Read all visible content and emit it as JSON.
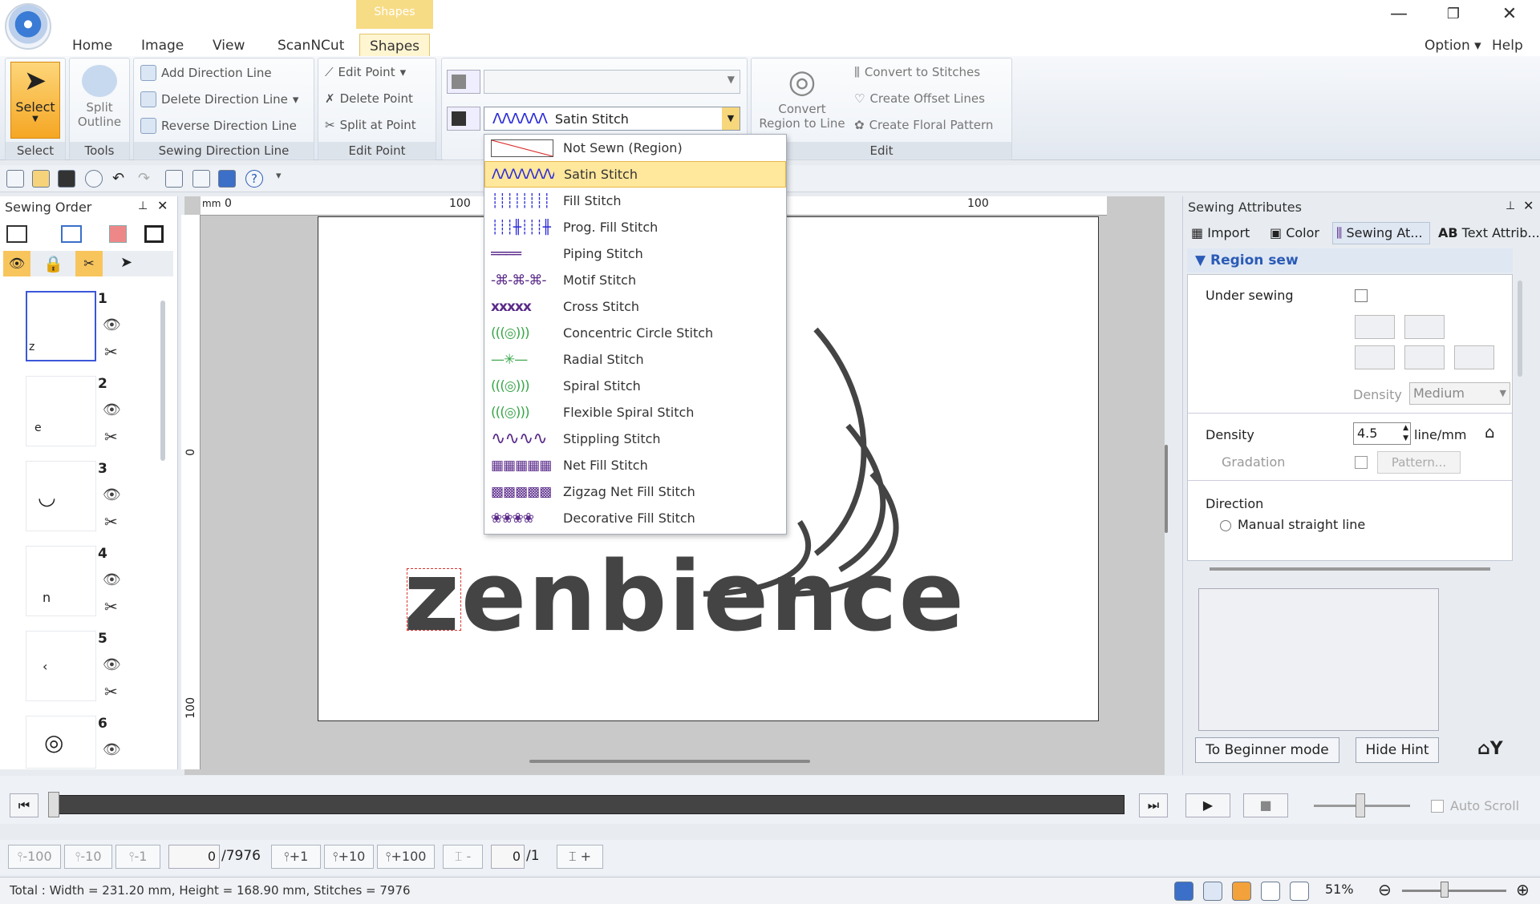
{
  "ribbon": {
    "context_tab": "Shapes",
    "tabs": [
      "Home",
      "Image",
      "View",
      "ScanNCut",
      "Shapes"
    ],
    "active_tab": "Shapes",
    "option_label": "Option",
    "help_label": "Help",
    "groups": {
      "select": {
        "label": "Select",
        "button": "Select"
      },
      "tools": {
        "label": "Tools",
        "button_l1": "Split",
        "button_l2": "Outline"
      },
      "sewing_direction": {
        "label": "Sewing Direction Line",
        "items": [
          "Add Direction Line",
          "Delete Direction Line",
          "Reverse Direction Line"
        ]
      },
      "edit_point": {
        "label": "Edit Point",
        "items": [
          "Edit Point",
          "Delete Point",
          "Split at Point"
        ]
      },
      "edit": {
        "label": "Edit",
        "convert_l1": "Convert",
        "convert_l2": "Region to Line",
        "items": [
          "Convert to Stitches",
          "Create Offset Lines",
          "Create Floral Pattern"
        ]
      }
    },
    "region_stitch_selected": "Satin Stitch"
  },
  "stitch_dropdown": {
    "items": [
      {
        "label": "Not Sewn (Region)",
        "swatch": "",
        "color": "#d33"
      },
      {
        "label": "Satin Stitch",
        "swatch": "ΛΛΛΛΛΛΛΛ",
        "color": "#2b2bd6",
        "selected": true
      },
      {
        "label": "Fill Stitch",
        "swatch": "┊┊┊┊┊┊┊┊┊┊",
        "color": "#2b2bd6"
      },
      {
        "label": "Prog. Fill Stitch",
        "swatch": "┊┊┊╫┊┊┊╫┊┊",
        "color": "#2b2bd6"
      },
      {
        "label": "Piping Stitch",
        "swatch": "════",
        "color": "#5a2a8a"
      },
      {
        "label": "Motif Stitch",
        "swatch": "-⌘-⌘-⌘-",
        "color": "#5a2a8a"
      },
      {
        "label": "Cross Stitch",
        "swatch": "xxxxx",
        "color": "#5a2a8a"
      },
      {
        "label": "Concentric Circle Stitch",
        "swatch": "(((◎)))",
        "color": "#3aa64a"
      },
      {
        "label": "Radial Stitch",
        "swatch": "—✳—",
        "color": "#3aa64a"
      },
      {
        "label": "Spiral Stitch",
        "swatch": "(((◎)))",
        "color": "#3aa64a"
      },
      {
        "label": "Flexible Spiral Stitch",
        "swatch": "(((◎)))",
        "color": "#3aa64a"
      },
      {
        "label": "Stippling Stitch",
        "swatch": "∿∿∿∿",
        "color": "#5a2a8a"
      },
      {
        "label": "Net Fill Stitch",
        "swatch": "▦▦▦▦▦",
        "color": "#5a2a8a"
      },
      {
        "label": "Zigzag Net Fill Stitch",
        "swatch": "▩▩▩▩▩",
        "color": "#5a2a8a"
      },
      {
        "label": "Decorative Fill Stitch",
        "swatch": "❀❀❀❀",
        "color": "#5a2a8a"
      }
    ]
  },
  "sewing_order": {
    "title": "Sewing Order",
    "items": [
      {
        "num": "1",
        "glyph": "z"
      },
      {
        "num": "2",
        "glyph": "e"
      },
      {
        "num": "3",
        "glyph": "◡"
      },
      {
        "num": "4",
        "glyph": "n"
      },
      {
        "num": "5",
        "glyph": "‹"
      },
      {
        "num": "6",
        "glyph": "◎"
      }
    ]
  },
  "canvas": {
    "ruler_unit": "mm",
    "ruler_h_labels": [
      "0",
      "100",
      "100"
    ],
    "ruler_v_labels": [
      "0",
      "100"
    ],
    "logo_text": "zenbience"
  },
  "sewing_attributes": {
    "title": "Sewing Attributes",
    "tabs": [
      "Import",
      "Color",
      "Sewing At...",
      "Text Attrib..."
    ],
    "section": "Region sew",
    "under_sewing": "Under sewing",
    "density_sub_label": "Density",
    "density_sub_value": "Medium",
    "density_label": "Density",
    "density_value": "4.5",
    "density_unit": "line/mm",
    "gradation": "Gradation",
    "pattern_btn": "Pattern...",
    "direction": "Direction",
    "manual_line": "Manual straight line",
    "beginner_btn": "To Beginner mode",
    "hide_hint_btn": "Hide Hint"
  },
  "stepper": {
    "buttons_left": [
      "-100",
      "-10",
      "-1"
    ],
    "current": "0",
    "total": "/7976",
    "buttons_right": [
      "+1",
      "+10",
      "+100"
    ],
    "color_current": "0",
    "color_total": "/1",
    "auto_scroll": "Auto Scroll"
  },
  "status": {
    "text": "Total : Width = 231.20 mm, Height = 168.90 mm, Stitches = 7976",
    "zoom": "51%"
  }
}
